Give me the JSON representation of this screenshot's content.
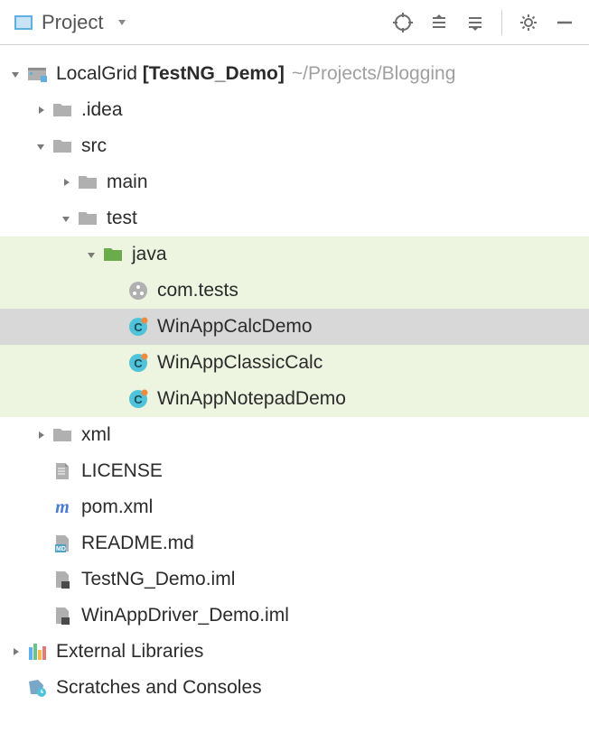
{
  "toolbar": {
    "title": "Project"
  },
  "tree": {
    "root": {
      "name": "LocalGrid",
      "context": "[TestNG_Demo]",
      "path": "~/Projects/Blogging"
    },
    "idea": ".idea",
    "src": "src",
    "main": "main",
    "test": "test",
    "java": "java",
    "pkg": "com.tests",
    "cls1": "WinAppCalcDemo",
    "cls2": "WinAppClassicCalc",
    "cls3": "WinAppNotepadDemo",
    "xml": "xml",
    "license": "LICENSE",
    "pom": "pom.xml",
    "readme": "README.md",
    "iml1": "TestNG_Demo.iml",
    "iml2": "WinAppDriver_Demo.iml",
    "extlib": "External Libraries",
    "scratches": "Scratches and Consoles"
  }
}
